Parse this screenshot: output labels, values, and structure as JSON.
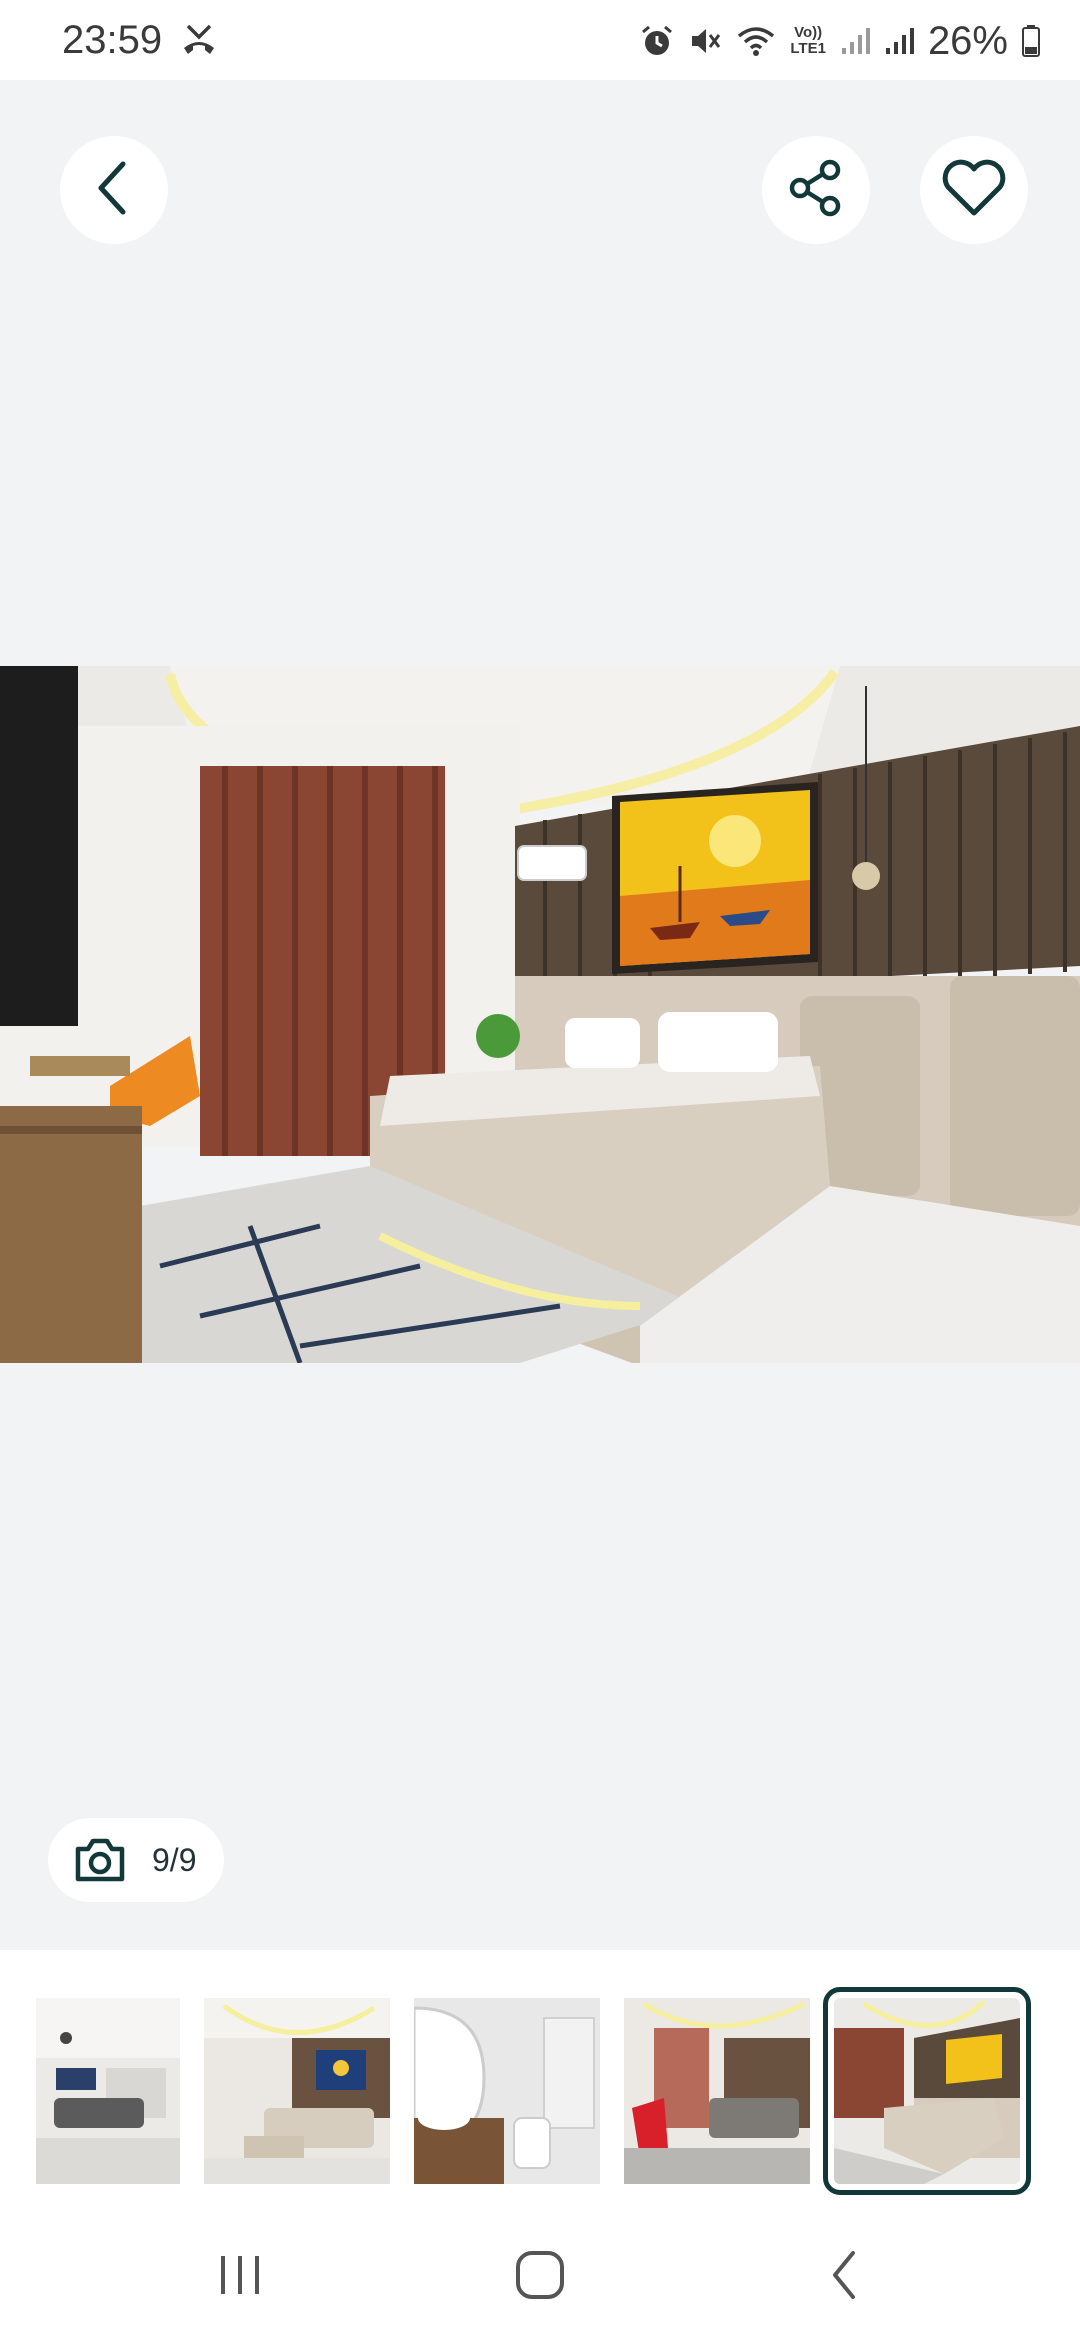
{
  "status_bar": {
    "time": "23:59",
    "battery": "26%",
    "icons": [
      "missed-call-icon",
      "alarm-icon",
      "mute-icon",
      "wifi-icon",
      "volte-icon",
      "signal-icon",
      "signal-icon",
      "battery-icon"
    ],
    "volte_line1": "Vo))",
    "volte_line2": "LTE1"
  },
  "viewer": {
    "photo_counter": "9/9",
    "icons": {
      "back": "chevron-left-icon",
      "share": "share-icon",
      "favorite": "heart-icon",
      "camera": "camera-icon"
    },
    "colors": {
      "background": "#f1f3f5",
      "accent": "#12383a"
    }
  },
  "thumbnails": [
    {
      "scene": "living-room",
      "selected": false
    },
    {
      "scene": "bedroom-blue-painting",
      "selected": false
    },
    {
      "scene": "bathroom",
      "selected": false
    },
    {
      "scene": "bedroom-red-chair",
      "selected": false
    },
    {
      "scene": "bedroom-yellow-painting",
      "selected": true
    }
  ],
  "nav_bar": {
    "icons": [
      "recent-apps-icon",
      "home-icon",
      "back-icon"
    ]
  }
}
